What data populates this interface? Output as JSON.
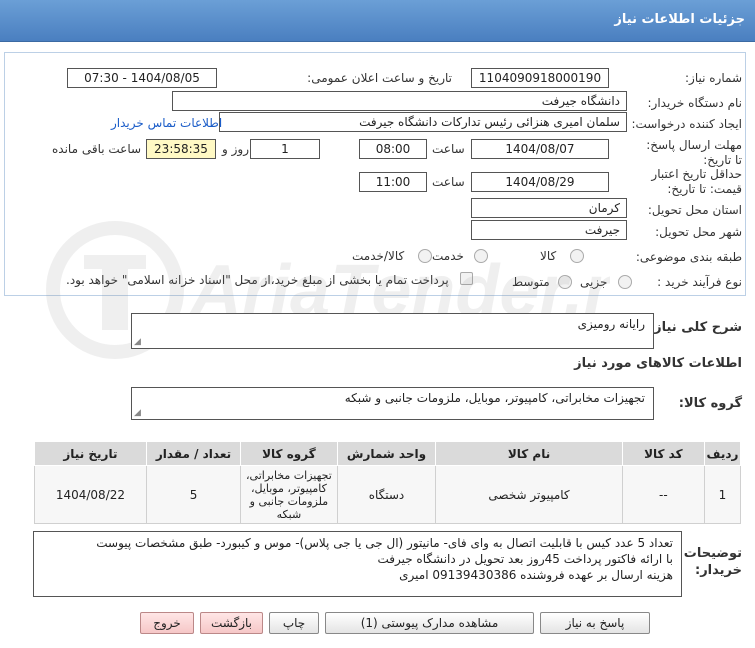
{
  "header": {
    "title": "جزئیات اطلاعات نیاز"
  },
  "form": {
    "need_number_label": "شماره نیاز:",
    "need_number": "1104090918000190",
    "announce_label": "تاریخ و ساعت اعلان عمومی:",
    "announce_value": "1404/08/05 - 07:30",
    "buyer_label": "نام دستگاه خریدار:",
    "buyer_value": "دانشگاه جیرفت",
    "creator_label": "ایجاد کننده درخواست:",
    "creator_value": "سلمان امیری هنزائی رئیس تداركات دانشگاه جیرفت",
    "contact_link": "اطلاعات تماس خریدار",
    "deadline_label": "مهلت ارسال پاسخ: تا تاریخ:",
    "deadline_date": "1404/08/07",
    "time_label": "ساعت",
    "deadline_time": "08:00",
    "days_value": "1",
    "days_label": "روز و",
    "remaining_value": "23:58:35",
    "remaining_label": "ساعت باقی مانده",
    "validity_label": "حداقل تاریخ اعتبار قیمت: تا تاریخ:",
    "validity_date": "1404/08/29",
    "validity_time": "11:00",
    "province_label": "استان محل تحویل:",
    "province_value": "کرمان",
    "city_label": "شهر محل تحویل:",
    "city_value": "جیرفت",
    "category_label": "طبقه بندی موضوعی:",
    "category_options": [
      "کالا",
      "خدمت",
      "کالا/خدمت"
    ],
    "process_label": "نوع فرآیند خرید :",
    "process_options": [
      "جزیی",
      "متوسط"
    ],
    "payment_note": "پرداخت تمام یا بخشی از مبلغ خرید،از محل \"اسناد خزانه اسلامی\" خواهد بود."
  },
  "summary": {
    "label": "شرح کلی نیاز:",
    "value": "رایانه رومیزی"
  },
  "goods_info_title": "اطلاعات کالاهای مورد نیاز",
  "goods_group": {
    "label": "گروه کالا:",
    "value": "تجهیزات مخابراتی، کامپیوتر، موبایل، ملزومات جانبی و شبکه"
  },
  "table": {
    "headers": [
      "ردیف",
      "کد کالا",
      "نام کالا",
      "واحد شمارش",
      "گروه کالا",
      "تعداد / مقدار",
      "تاریخ نیاز"
    ],
    "rows": [
      {
        "row": "1",
        "code": "--",
        "name": "کامپیوتر شخصی",
        "unit": "دستگاه",
        "group": "تجهیزات مخابراتی، کامپیوتر، موبایل، ملزومات جانبی و شبکه",
        "qty": "5",
        "date": "1404/08/22"
      }
    ]
  },
  "buyer_notes": {
    "label": "توضیحات خریدار:",
    "lines": [
      "تعداد 5 عدد کیس با قابلیت اتصال به وای فای- مانیتور (ال جی یا جی پلاس)- موس و کیبورد- طبق مشخصات پیوست",
      "با ارائه فاکتور پرداخت 45روز بعد تحویل در دانشگاه جیرفت",
      "هزینه ارسال بر عهده فروشنده 09139430386 امیری"
    ]
  },
  "buttons": {
    "reply": "پاسخ به نیاز",
    "attachments": "مشاهده مدارک پیوستی (1)",
    "print": "چاپ",
    "back": "بازگشت",
    "exit": "خروج"
  },
  "watermark_text": "AriaTender.neT",
  "colors": {
    "header": "#5a8ccb",
    "link": "#1a5cc8",
    "remaining_bg": "#fff9c4",
    "pink_button": "#f6c7c7"
  }
}
